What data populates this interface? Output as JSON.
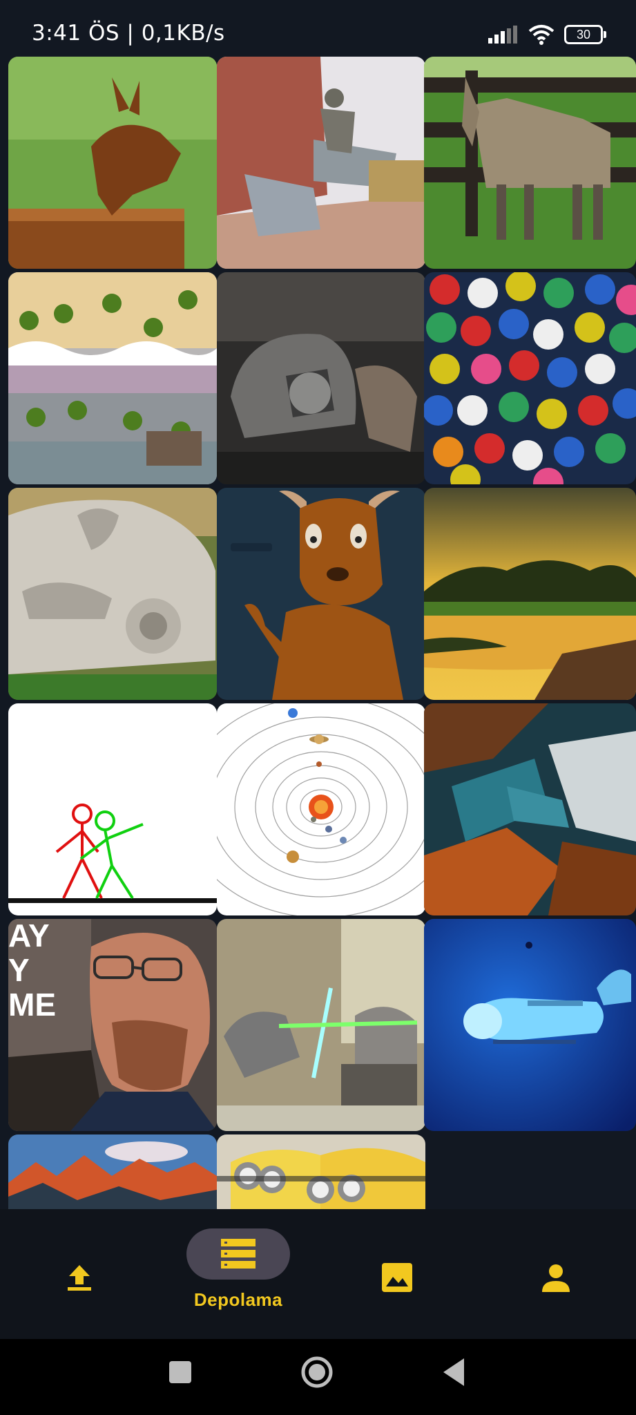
{
  "status_bar": {
    "time": "3:41 ÖS | 0,1KB/s",
    "battery": "30",
    "icons": [
      "signal-icon",
      "wifi-icon",
      "battery-icon"
    ]
  },
  "gallery": {
    "items": [
      {
        "name": "rust-hare-sculpture"
      },
      {
        "name": "bronze-horse-rider-statue"
      },
      {
        "name": "zebra-donkey-hybrid"
      },
      {
        "name": "aerial-beach-palms"
      },
      {
        "name": "gladiator-helmet"
      },
      {
        "name": "colorful-plastic-gears"
      },
      {
        "name": "stone-face-sculpture"
      },
      {
        "name": "cartoon-deer"
      },
      {
        "name": "savanna-sunset-lake"
      },
      {
        "name": "stick-figures-animation"
      },
      {
        "name": "solar-system-diagram"
      },
      {
        "name": "abstract-motion-blur"
      },
      {
        "name": "bald-man-glasses-meme"
      },
      {
        "name": "cats-lightsabers"
      },
      {
        "name": "underwater-submersible"
      },
      {
        "name": "mountain-range-sunrise"
      },
      {
        "name": "minions"
      }
    ],
    "meme_text": [
      "AY",
      "Y",
      "ME"
    ]
  },
  "bottom_nav": {
    "active_label": "Depolama",
    "items": [
      {
        "icon": "upload-icon"
      },
      {
        "icon": "storage-list-icon",
        "label": "Depolama"
      },
      {
        "icon": "image-icon"
      },
      {
        "icon": "person-icon"
      }
    ],
    "accent": "#f2c81f",
    "pill_color": "#4a4654"
  },
  "system_nav": {
    "icons": [
      "recents-square-icon",
      "home-circle-icon",
      "back-triangle-icon"
    ]
  }
}
